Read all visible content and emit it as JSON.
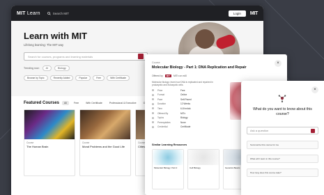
{
  "nav": {
    "logo_bold": "MIT",
    "logo_light": "Learn",
    "search_label": "Search MIT",
    "login_label": "Login",
    "mit_mark": "MIT"
  },
  "hero": {
    "title": "Learn with MIT",
    "subtitle": "Lifelong learning: The MIT way",
    "search_placeholder": "Search for courses, programs and learning materials",
    "explore_label": "Trending now:",
    "explore_tags": [
      "AI",
      "Biology"
    ],
    "chips": [
      "Browse by Topic",
      "Recently Added",
      "Popular",
      "Free",
      "With Certificate"
    ]
  },
  "featured": {
    "title": "Featured Courses",
    "tabs": [
      "All",
      "Free",
      "With Certificate",
      "Professional & Executive",
      "Online"
    ],
    "cards": [
      {
        "meta": "Course",
        "title": "The Human Brain"
      },
      {
        "meta": "Course",
        "title": "Moral Problems and the Good Life"
      },
      {
        "meta": "Course",
        "title": "Cities & Society"
      }
    ]
  },
  "panel": {
    "kicker": "Course",
    "title": "Molecular Biology - Part 1: DNA Replication and Repair",
    "by_prefix": "Offered by",
    "by_badge": "MIT",
    "by_name": "MITx on edX",
    "description": "Molecular biology: learn how DNA is replicated and repaired in prokaryotic and eukaryotic cells.",
    "rows": [
      {
        "k": "Price",
        "v": "Free"
      },
      {
        "k": "Format",
        "v": "Online"
      },
      {
        "k": "Pace",
        "v": "Self-Paced"
      },
      {
        "k": "Duration",
        "v": "12 Weeks"
      },
      {
        "k": "Time",
        "v": "6-8 hrs/wk"
      },
      {
        "k": "Offered By",
        "v": "MITx"
      },
      {
        "k": "Topics",
        "v": "Biology"
      },
      {
        "k": "Prerequisites",
        "v": "None"
      },
      {
        "k": "Credential",
        "v": "Certificate"
      }
    ],
    "similar_title": "Similar Learning Resources",
    "similar": [
      {
        "title": "Molecular Biology: Part 2"
      },
      {
        "title": "Cell Biology"
      },
      {
        "title": "Genetics Basics"
      }
    ]
  },
  "ai": {
    "question": "What do you want to know about this course?",
    "input_placeholder": "Ask a question",
    "suggestions": [
      "Summarize this course for me",
      "What will I learn in this course?",
      "How long does this course take?"
    ]
  }
}
